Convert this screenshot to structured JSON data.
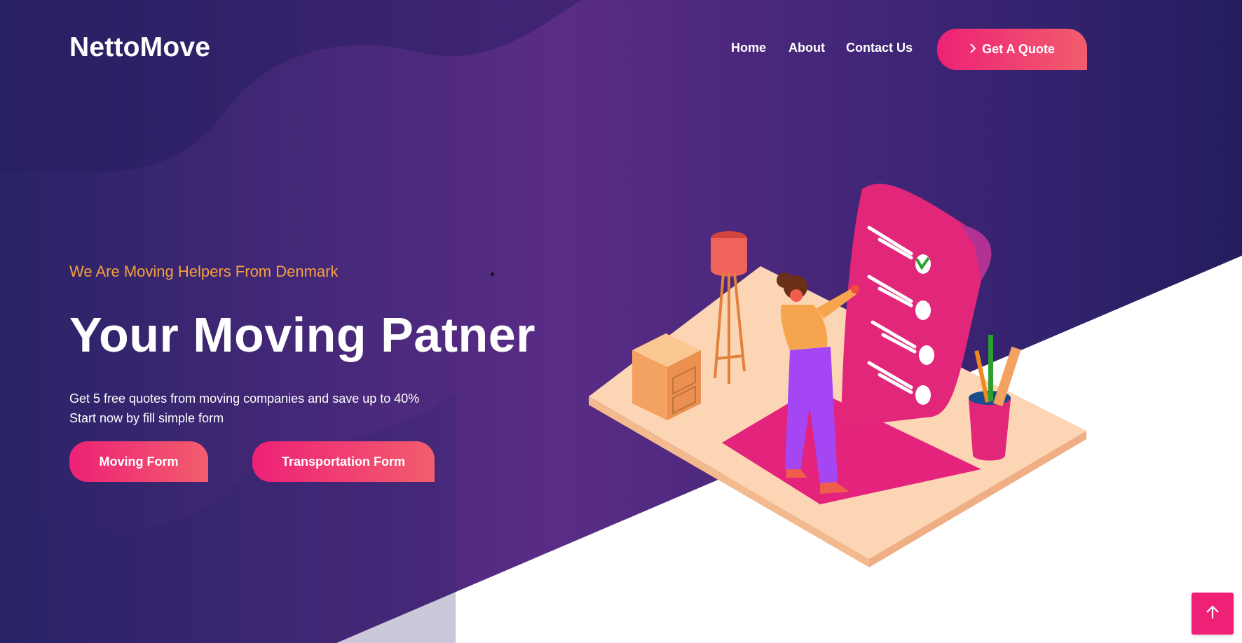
{
  "brand": {
    "logo_text": "NettoMove"
  },
  "nav": {
    "items": [
      {
        "label": "Home"
      },
      {
        "label": "About"
      },
      {
        "label": "Contact Us"
      }
    ],
    "cta_label": "Get A Quote",
    "cta_icon": "chevron-right-icon"
  },
  "hero": {
    "tagline": "We Are Moving Helpers From Denmark",
    "headline": "Your Moving Patner",
    "description_lines": [
      "Get 5 free quotes from moving companies and save up to 40%",
      "Start now by fill simple form"
    ],
    "buttons": [
      {
        "label": "Moving Form"
      },
      {
        "label": "Transportation Form"
      }
    ]
  },
  "back_to_top": {
    "icon": "arrow-up-icon"
  },
  "colors": {
    "accent": "#ee2176",
    "accent_end": "#f25d6d",
    "tagline": "#f6a13c",
    "bg_dark": "#2a1f63",
    "bg_purple": "#5b2d86"
  }
}
